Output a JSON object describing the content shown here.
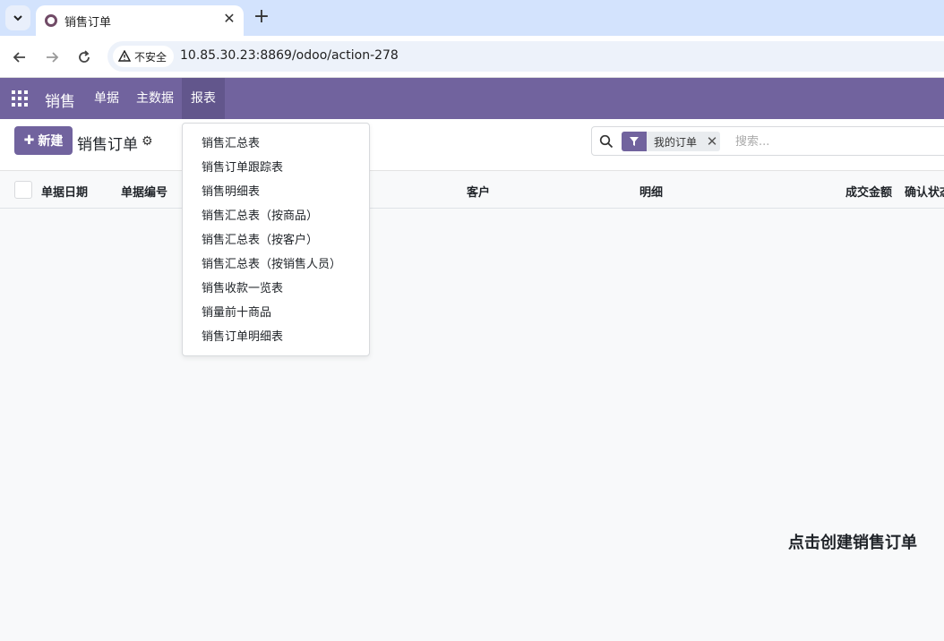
{
  "browser": {
    "tab_title": "销售订单",
    "security_label": "不安全",
    "url": "10.85.30.23:8869/odoo/action-278"
  },
  "navbar": {
    "app_name": "销售",
    "menus": [
      {
        "label": "单据"
      },
      {
        "label": "主数据"
      },
      {
        "label": "报表"
      }
    ]
  },
  "control_panel": {
    "new_button": "新建",
    "title": "销售订单",
    "search": {
      "facet": "我的订单",
      "placeholder": "搜索..."
    }
  },
  "list": {
    "columns": [
      "单据日期",
      "单据编号",
      "客户",
      "明细",
      "成交金额",
      "确认状态"
    ]
  },
  "reports_dropdown": {
    "items": [
      "销售汇总表",
      "销售订单跟踪表",
      "销售明细表",
      "销售汇总表（按商品）",
      "销售汇总表（按客户）",
      "销售汇总表（按销售人员）",
      "销售收款一览表",
      "销量前十商品",
      "销售订单明细表"
    ]
  },
  "empty_state": {
    "hint": "点击创建销售订单"
  },
  "colors": {
    "brand": "#71639e",
    "brand_active": "#62568c"
  }
}
